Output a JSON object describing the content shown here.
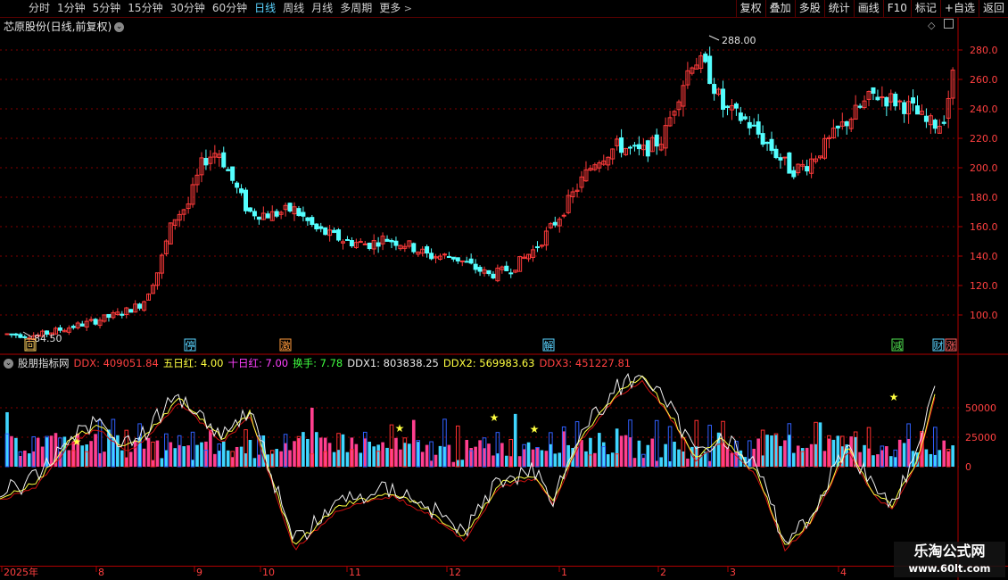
{
  "toolbar": {
    "periods": [
      "分时",
      "1分钟",
      "5分钟",
      "15分钟",
      "30分钟",
      "60分钟",
      "日线",
      "周线",
      "月线",
      "多周期",
      "更多"
    ],
    "active_period": "日线",
    "right_buttons": [
      "复权",
      "叠加",
      "多股",
      "统计",
      "画线",
      "F10",
      "标记",
      "+自选",
      "返回"
    ]
  },
  "kline": {
    "title": "芯原股份(日线,前复权)",
    "price_ticks": [
      "280.0",
      "260.0",
      "240.0",
      "220.0",
      "200.0",
      "180.0",
      "160.0",
      "140.0",
      "120.0",
      "100.0"
    ],
    "high_label": "288.00",
    "low_label": "84.50",
    "markers": [
      {
        "label": "回",
        "color": "#ffd060"
      },
      {
        "label": "停",
        "color": "#5ad3ff"
      },
      {
        "label": "激",
        "color": "#ff9a3c"
      },
      {
        "label": "解",
        "color": "#5ad3ff"
      },
      {
        "label": "减",
        "color": "#50e050"
      },
      {
        "label": "财",
        "color": "#5ad3ff"
      },
      {
        "label": "涨",
        "color": "#ff6060"
      }
    ]
  },
  "indicator": {
    "name": "股朋指标网",
    "items": [
      {
        "label": "DDX: 409051.84",
        "color": "#ff4040"
      },
      {
        "label": "五日红: 4.00",
        "color": "#ffff40"
      },
      {
        "label": "十日红: 7.00",
        "color": "#ff40ff"
      },
      {
        "label": "换手: 7.78",
        "color": "#40ff40"
      },
      {
        "label": "DDX1: 803838.25",
        "color": "#e8e8e8"
      },
      {
        "label": "DDX2: 569983.63",
        "color": "#ffff40"
      },
      {
        "label": "DDX3: 451227.81",
        "color": "#ff4040"
      }
    ],
    "ticks": [
      "50000",
      "25000",
      "0"
    ]
  },
  "time_axis": [
    "2025年",
    "8",
    "9",
    "10",
    "11",
    "12",
    "1",
    "2",
    "3",
    "4"
  ],
  "watermark": {
    "line1": "乐淘公式网",
    "line2": "www.60lt.com"
  },
  "colors": {
    "up": "#ff3b3b",
    "down": "#54ffff",
    "grid": "#800000",
    "axis": "#b00000"
  }
}
